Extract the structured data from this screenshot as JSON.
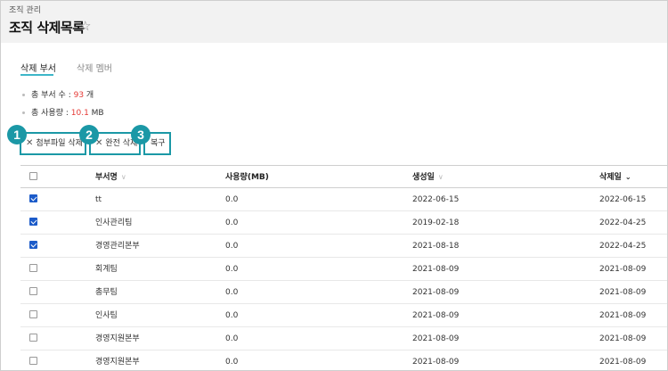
{
  "header": {
    "breadcrumb": "조직 관리",
    "title": "조직 삭제목록",
    "star_icon": "☆"
  },
  "tabs": [
    {
      "label": "삭제 부서",
      "active": true
    },
    {
      "label": "삭제 멤버",
      "active": false
    }
  ],
  "summary": {
    "dept_count_label": "총 부서 수 : ",
    "dept_count": "93",
    "dept_count_unit": " 개",
    "usage_label": "총 사용량 : ",
    "usage_value": "10.1",
    "usage_unit": " MB"
  },
  "actions": {
    "delete_attachments": "첨부파일 삭제",
    "delete_permanently": "완전 삭제",
    "restore": "복구",
    "x_icon": "✕",
    "badges": [
      "1",
      "2",
      "3"
    ]
  },
  "table": {
    "columns": {
      "name": "부서명",
      "size": "사용량(MB)",
      "created": "생성일",
      "deleted": "삭제일"
    },
    "sort_icons": {
      "inactive": "∨",
      "active": "⌄"
    },
    "rows": [
      {
        "checked": true,
        "name": "tt",
        "size": "0.0",
        "created": "2022-06-15",
        "deleted": "2022-06-15"
      },
      {
        "checked": true,
        "name": "인사관리팀",
        "size": "0.0",
        "created": "2019-02-18",
        "deleted": "2022-04-25"
      },
      {
        "checked": true,
        "name": "경영관리본부",
        "size": "0.0",
        "created": "2021-08-18",
        "deleted": "2022-04-25"
      },
      {
        "checked": false,
        "name": "회계팀",
        "size": "0.0",
        "created": "2021-08-09",
        "deleted": "2021-08-09"
      },
      {
        "checked": false,
        "name": "총무팀",
        "size": "0.0",
        "created": "2021-08-09",
        "deleted": "2021-08-09"
      },
      {
        "checked": false,
        "name": "인사팀",
        "size": "0.0",
        "created": "2021-08-09",
        "deleted": "2021-08-09"
      },
      {
        "checked": false,
        "name": "경영지원본부",
        "size": "0.0",
        "created": "2021-08-09",
        "deleted": "2021-08-09"
      },
      {
        "checked": false,
        "name": "경영지원본부",
        "size": "0.0",
        "created": "2021-08-09",
        "deleted": "2021-08-09"
      }
    ]
  }
}
